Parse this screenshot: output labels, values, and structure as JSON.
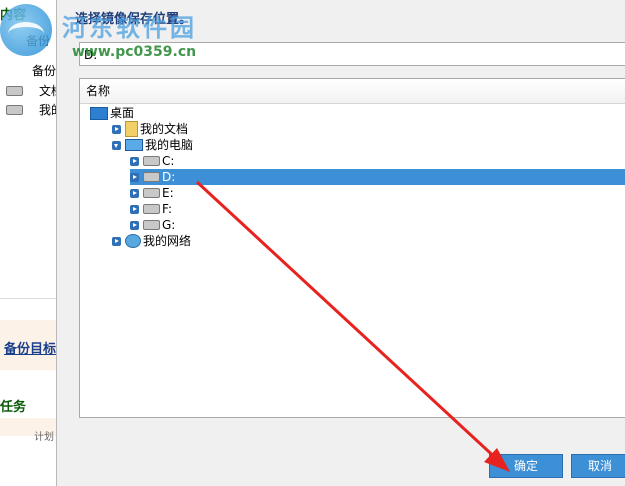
{
  "background": {
    "header": "内容",
    "row1": "备份",
    "row2": "备份",
    "row3": "文档",
    "row4": "我的",
    "link": "备份目标",
    "task": "任务",
    "small": "计划"
  },
  "watermark": {
    "title": "河东软件园",
    "url": "www.pc0359.cn"
  },
  "dialog": {
    "title": "选择镜像保存位置。",
    "path_value": "D:",
    "column_header": "名称",
    "tree": [
      {
        "label": "桌面",
        "icon": "desktop-icon",
        "expander": "none",
        "level": 0
      },
      {
        "label": "我的文档",
        "icon": "documents-folder-icon",
        "expander": "collapsed",
        "level": 1
      },
      {
        "label": "我的电脑",
        "icon": "computer-icon",
        "expander": "expanded",
        "level": 1
      },
      {
        "label": "C:",
        "icon": "drive-icon",
        "expander": "collapsed",
        "level": 2
      },
      {
        "label": "D:",
        "icon": "drive-icon",
        "expander": "collapsed",
        "level": 2,
        "selected": true
      },
      {
        "label": "E:",
        "icon": "drive-icon",
        "expander": "collapsed",
        "level": 2
      },
      {
        "label": "F:",
        "icon": "drive-icon",
        "expander": "collapsed",
        "level": 2
      },
      {
        "label": "G:",
        "icon": "drive-icon",
        "expander": "collapsed",
        "level": 2
      },
      {
        "label": "我的网络",
        "icon": "network-icon",
        "expander": "collapsed",
        "level": 1
      }
    ],
    "ok_label": "确定",
    "cancel_label": "取消"
  },
  "colors": {
    "selection": "#3d8fd6",
    "arrow": "#e8231f",
    "button": "#3d8fd6"
  }
}
